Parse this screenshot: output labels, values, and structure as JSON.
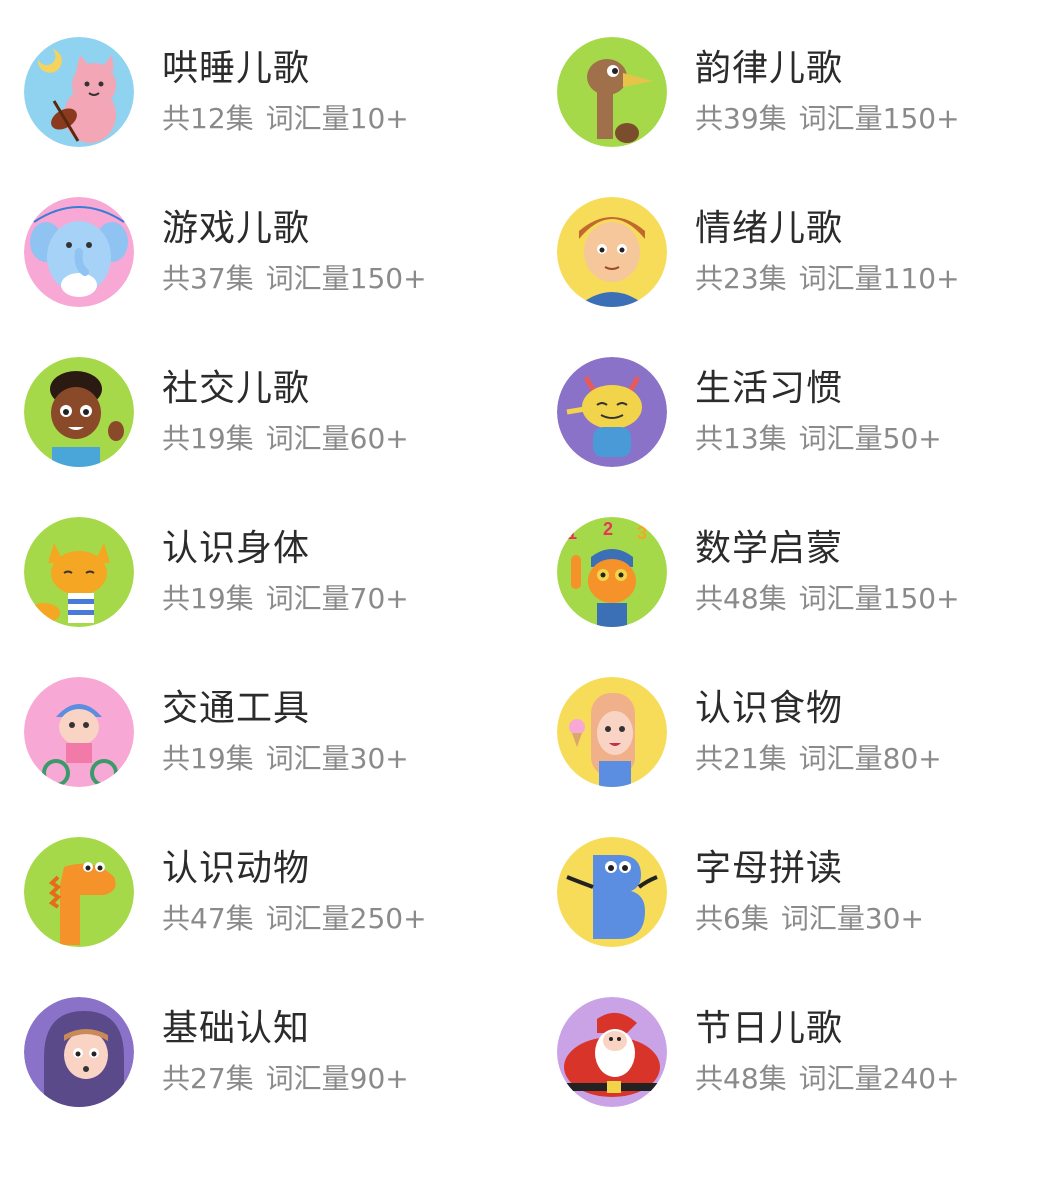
{
  "items": [
    {
      "title": "哄睡儿歌",
      "episodes": "共12集",
      "vocab": "词汇量10+",
      "icon": "cat-violin-icon",
      "bg": "#8fd3f0"
    },
    {
      "title": "韵律儿歌",
      "episodes": "共39集",
      "vocab": "词汇量150+",
      "icon": "ostrich-icon",
      "bg": "#a6d94a"
    },
    {
      "title": "游戏儿歌",
      "episodes": "共37集",
      "vocab": "词汇量150+",
      "icon": "elephant-icon",
      "bg": "#f7a8d4"
    },
    {
      "title": "情绪儿歌",
      "episodes": "共23集",
      "vocab": "词汇量110+",
      "icon": "boy-icon",
      "bg": "#f7dc5a"
    },
    {
      "title": "社交儿歌",
      "episodes": "共19集",
      "vocab": "词汇量60+",
      "icon": "kid-waving-icon",
      "bg": "#a6d94a"
    },
    {
      "title": "生活习惯",
      "episodes": "共13集",
      "vocab": "词汇量50+",
      "icon": "monster-icon",
      "bg": "#8b72c9"
    },
    {
      "title": "认识身体",
      "episodes": "共19集",
      "vocab": "词汇量70+",
      "icon": "fox-icon",
      "bg": "#a6d94a"
    },
    {
      "title": "数学启蒙",
      "episodes": "共48集",
      "vocab": "词汇量150+",
      "icon": "numbers-kid-icon",
      "bg": "#a6d94a"
    },
    {
      "title": "交通工具",
      "episodes": "共19集",
      "vocab": "词汇量30+",
      "icon": "cyclist-icon",
      "bg": "#f7a8d4"
    },
    {
      "title": "认识食物",
      "episodes": "共21集",
      "vocab": "词汇量80+",
      "icon": "girl-icecream-icon",
      "bg": "#f7dc5a"
    },
    {
      "title": "认识动物",
      "episodes": "共47集",
      "vocab": "词汇量250+",
      "icon": "dinosaur-icon",
      "bg": "#a6d94a"
    },
    {
      "title": "字母拼读",
      "episodes": "共6集",
      "vocab": "词汇量30+",
      "icon": "letter-b-icon",
      "bg": "#f7dc5a"
    },
    {
      "title": "基础认知",
      "episodes": "共27集",
      "vocab": "词汇量90+",
      "icon": "hooded-girl-icon",
      "bg": "#8b72c9"
    },
    {
      "title": "节日儿歌",
      "episodes": "共48集",
      "vocab": "词汇量240+",
      "icon": "santa-icon",
      "bg": "#c9a3e6"
    }
  ],
  "numbers_badge": [
    "1",
    "2",
    "3"
  ]
}
